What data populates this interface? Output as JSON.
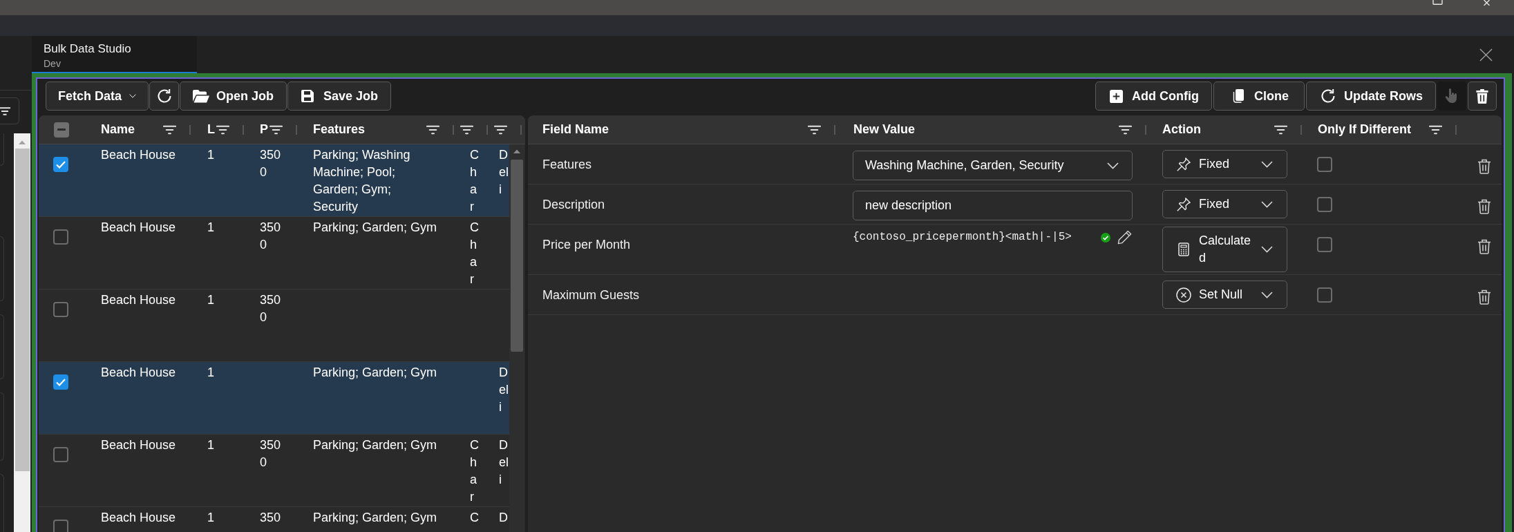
{
  "tabs": [
    {
      "title": "Bulk Data Studio",
      "subtitle": "Dev",
      "selected": true
    }
  ],
  "toolbar": {
    "left": [
      {
        "kind": "dropdown",
        "label": "Fetch Data"
      },
      {
        "kind": "icon"
      },
      {
        "kind": "button",
        "label": "Open Job"
      },
      {
        "kind": "button",
        "label": "Save Job"
      }
    ],
    "right": [
      {
        "kind": "button",
        "label": "Add Config",
        "disabled": false
      },
      {
        "kind": "button",
        "label": "Clone",
        "disabled": false
      },
      {
        "kind": "button",
        "label": "Update Rows",
        "disabled": false
      },
      {
        "kind": "icon",
        "disabled": true
      },
      {
        "kind": "icon",
        "disabled": false
      }
    ]
  },
  "records_grid": {
    "select_all": {
      "indeterminate": true
    },
    "columns": [
      {
        "label": "Name",
        "filter": true
      },
      {
        "label": "L",
        "filter": true
      },
      {
        "label": "P",
        "filter": true
      },
      {
        "label": "Features",
        "filter": true
      },
      {
        "filter": true
      },
      {
        "filter": true
      }
    ],
    "rows": [
      {
        "selected": true,
        "cells": [
          "Beach House",
          "1",
          "3500",
          "Parking; Washing Machine; Pool; Garden; Gym; Security",
          "Char",
          "Deli"
        ]
      },
      {
        "selected": false,
        "cells": [
          "Beach House",
          "1",
          "3500",
          "Parking; Garden; Gym",
          "Char",
          null
        ]
      },
      {
        "selected": false,
        "cells": [
          "Beach House",
          "1",
          "3500",
          null,
          null,
          null
        ]
      },
      {
        "selected": true,
        "cells": [
          "Beach House",
          "1",
          null,
          "Parking; Garden; Gym",
          null,
          "Deli"
        ]
      },
      {
        "selected": false,
        "cells": [
          "Beach House",
          "1",
          "3500",
          "Parking; Garden; Gym",
          "Char",
          "Deli"
        ]
      },
      {
        "selected": false,
        "cells": [
          "Beach House",
          "1",
          "350",
          "Parking; Garden; Gym",
          "C",
          "D"
        ]
      }
    ]
  },
  "config_grid": {
    "columns": [
      {
        "label": "Field Name",
        "filter": true
      },
      {
        "label": "New Value",
        "filter": true
      },
      {
        "label": "Action",
        "filter": true
      },
      {
        "label": "Only If Different",
        "filter": true
      }
    ],
    "rows": [
      {
        "field": "Features",
        "value": {
          "kind": "dropdown",
          "text": "Washing Machine, Garden, Security"
        },
        "action": {
          "kind": "fixed",
          "label": "Fixed"
        },
        "only_if_different": false
      },
      {
        "field": "Description",
        "value": {
          "kind": "input",
          "text": "new description"
        },
        "action": {
          "kind": "fixed",
          "label": "Fixed"
        },
        "only_if_different": false
      },
      {
        "field": "Price per Month",
        "value": {
          "kind": "formula",
          "text": "{contoso_pricepermonth}<math|-|5>",
          "valid": true
        },
        "action": {
          "kind": "calculated",
          "label": "Calculated"
        },
        "only_if_different": false
      },
      {
        "field": "Maximum Guests",
        "action": {
          "kind": "set_null",
          "label": "Set Null"
        },
        "only_if_different": false
      }
    ]
  }
}
